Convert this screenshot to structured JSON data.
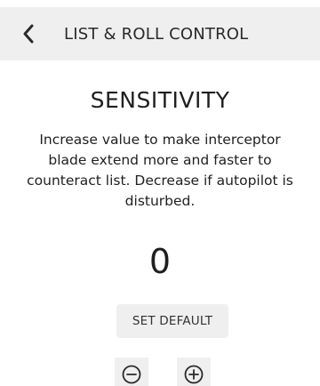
{
  "header": {
    "back_icon": "chevron-left-icon",
    "title": "LIST & ROLL CONTROL"
  },
  "main": {
    "title": "SENSITIVITY",
    "description": "Increase value to make interceptor blade extend more and faster to counteract list. Decrease if autopilot is disturbed.",
    "value": "0",
    "set_default_label": "SET DEFAULT",
    "decrease_icon": "minus-circle-icon",
    "increase_icon": "plus-circle-icon"
  },
  "colors": {
    "background": "#ffffff",
    "panel": "#efefef",
    "text": "#1f1f1f"
  }
}
